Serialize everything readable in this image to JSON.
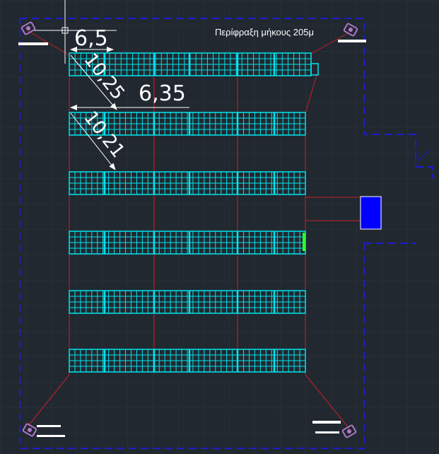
{
  "drawing": {
    "perimeter_note": "Περίφραξη μήκους 205μ",
    "dimensions": {
      "top_width": "6,5",
      "top_diag": "10,25",
      "second_width": "6,35",
      "second_diag": "10,21"
    },
    "panel_rows": 6,
    "colors": {
      "background": "#212830",
      "grid": "#2b333c",
      "panel": "#00e5ee",
      "support": "#c8202a",
      "fence": "#1c1cd0",
      "inverter": "#0000ff",
      "text": "#ffffff",
      "camera": "#b077c8"
    },
    "icons": [
      "camera-icon-top-left",
      "camera-icon-top-right",
      "camera-icon-bottom-left",
      "camera-icon-bottom-right"
    ]
  }
}
